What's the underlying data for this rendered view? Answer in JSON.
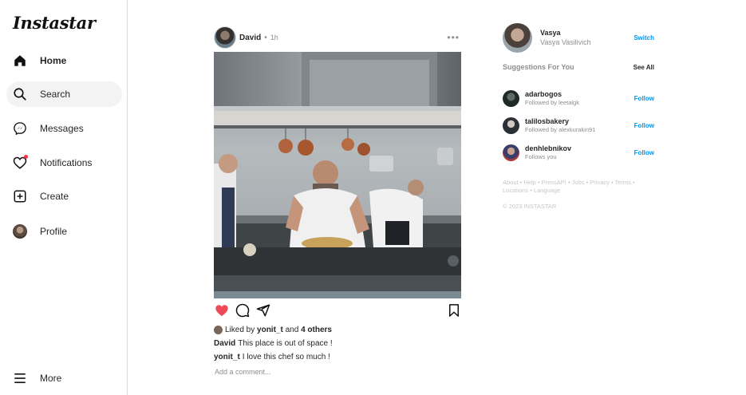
{
  "app": {
    "logo": "Instastar"
  },
  "sidebar": {
    "items": [
      {
        "label": "Home",
        "icon": "home-icon"
      },
      {
        "label": "Search",
        "icon": "search-icon"
      },
      {
        "label": "Messages",
        "icon": "messenger-icon"
      },
      {
        "label": "Notifications",
        "icon": "heart-icon"
      },
      {
        "label": "Create",
        "icon": "plus-square-icon"
      },
      {
        "label": "Profile",
        "icon": "avatar"
      }
    ],
    "more": {
      "label": "More",
      "icon": "hamburger-icon"
    }
  },
  "post": {
    "user": "David",
    "separator": "•",
    "time": "1h",
    "more": "•••",
    "likes": {
      "prefix": "Liked by",
      "user": "yonit_t",
      "and": "and",
      "others": "4 others"
    },
    "comments": [
      {
        "user": "David",
        "text": "This place is out of space !"
      },
      {
        "user": "yonit_t",
        "text": "I love this chef so much !"
      }
    ],
    "add_comment_placeholder": "Add a comment..."
  },
  "current_user": {
    "username": "Vasya",
    "full_name": "Vasya Vasilivich",
    "switch_label": "Switch"
  },
  "suggestions": {
    "title": "Suggestions For You",
    "see_all": "See All",
    "items": [
      {
        "username": "adarbogos",
        "subtitle": "Followed by leetalgk",
        "action": "Follow"
      },
      {
        "username": "talilosbakery",
        "subtitle": "Followed by alexkurakin91",
        "action": "Follow"
      },
      {
        "username": "denhlebnikov",
        "subtitle": "Follows you",
        "action": "Follow"
      }
    ]
  },
  "footer": {
    "links": "About • Help • PressAPI • Jobs • Privacy • Terms • Locations • Language",
    "copyright": "© 2023 INSTASTAR"
  },
  "colors": {
    "accent": "#0095f6",
    "like_red": "#ed4956",
    "notification_dot": "#ff3040"
  }
}
